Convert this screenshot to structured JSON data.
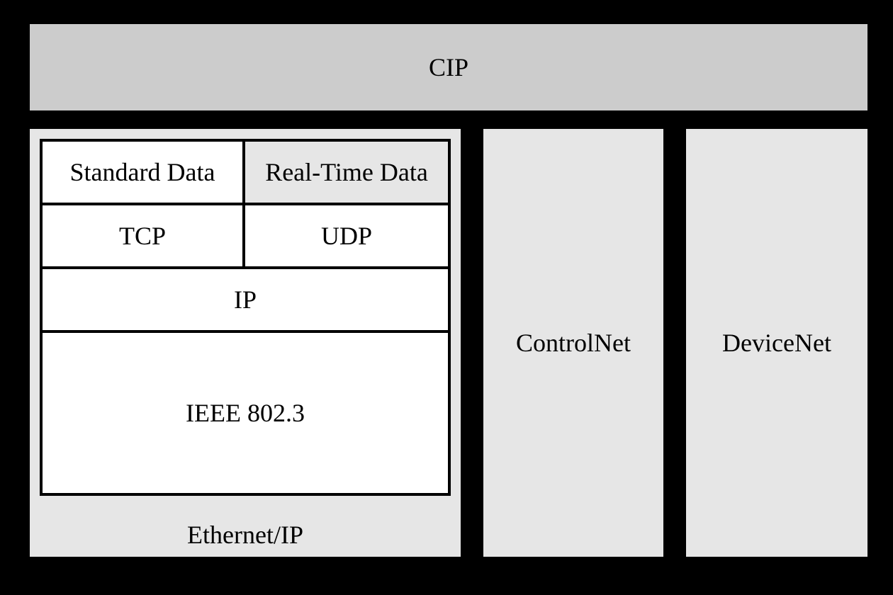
{
  "diagram": {
    "top": {
      "label": "CIP"
    },
    "ethernet_ip": {
      "label": "Ethernet/IP",
      "data_row": {
        "standard": "Standard Data",
        "realtime": "Real-Time Data"
      },
      "transport_row": {
        "tcp": "TCP",
        "udp": "UDP"
      },
      "network": "IP",
      "link": "IEEE 802.3"
    },
    "controlnet": {
      "label": "ControlNet"
    },
    "devicenet": {
      "label": "DeviceNet"
    }
  }
}
